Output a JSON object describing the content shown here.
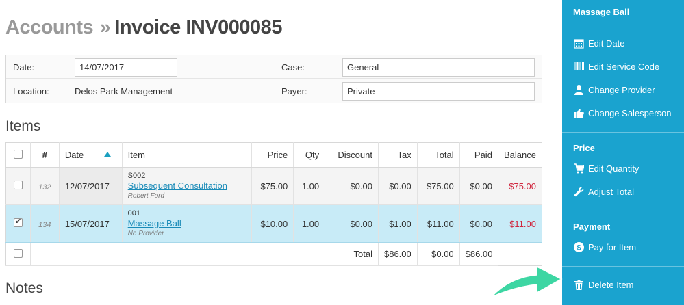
{
  "header": {
    "breadcrumb": "Accounts",
    "separator": "»",
    "title": "Invoice INV000085"
  },
  "info": {
    "date_label": "Date:",
    "date_value": "14/07/2017",
    "case_label": "Case:",
    "case_value": "General",
    "location_label": "Location:",
    "location_value": "Delos Park Management",
    "payer_label": "Payer:",
    "payer_value": "Private"
  },
  "items_heading": "Items",
  "notes_heading": "Notes",
  "table": {
    "columns": [
      "#",
      "Date",
      "Item",
      "Price",
      "Qty",
      "Discount",
      "Tax",
      "Total",
      "Paid",
      "Balance"
    ],
    "rows": [
      {
        "checked": false,
        "num": "132",
        "date": "12/07/2017",
        "code": "S002",
        "item": "Subsequent Consultation",
        "provider": "Robert Ford",
        "price": "$75.00",
        "qty": "1.00",
        "discount": "$0.00",
        "tax": "$0.00",
        "total": "$75.00",
        "paid": "$0.00",
        "balance": "$75.00"
      },
      {
        "checked": true,
        "num": "134",
        "date": "15/07/2017",
        "code": "001",
        "item": "Massage Ball",
        "provider": "No Provider",
        "price": "$10.00",
        "qty": "1.00",
        "discount": "$0.00",
        "tax": "$1.00",
        "total": "$11.00",
        "paid": "$0.00",
        "balance": "$11.00"
      }
    ],
    "totals": {
      "label": "Total",
      "total": "$86.00",
      "paid": "$0.00",
      "balance": "$86.00"
    }
  },
  "sidebar": {
    "title": "Massage Ball",
    "items_a": [
      {
        "label": "Edit Date",
        "icon": "calendar-icon"
      },
      {
        "label": "Edit Service Code",
        "icon": "barcode-icon"
      },
      {
        "label": "Change Provider",
        "icon": "user-icon"
      },
      {
        "label": "Change Salesperson",
        "icon": "thumbs-up-icon"
      }
    ],
    "price_heading": "Price",
    "items_b": [
      {
        "label": "Edit Quantity",
        "icon": "cart-icon"
      },
      {
        "label": "Adjust Total",
        "icon": "wrench-icon"
      }
    ],
    "payment_heading": "Payment",
    "pay_for_item": "Pay for Item",
    "delete_item": "Delete Item"
  },
  "colors": {
    "sidebar": "#1aa3cf",
    "selected_row": "#c8ebf7",
    "link": "#1a8bb8",
    "balance": "#d0253d",
    "arrow": "#3dd6a3"
  }
}
